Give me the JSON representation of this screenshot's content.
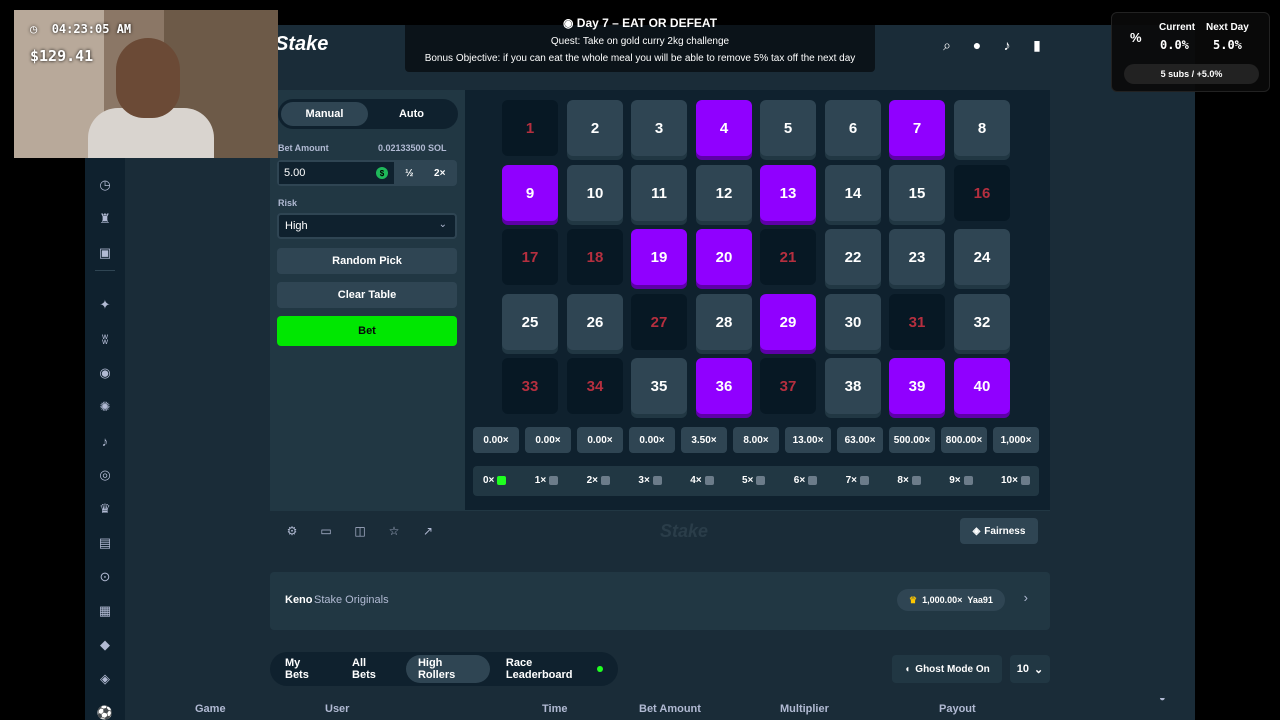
{
  "topbar": {
    "logo": "Stake"
  },
  "panel": {
    "tab_manual": "Manual",
    "tab_auto": "Auto",
    "bet_amount_label": "Bet Amount",
    "bet_amount_sol": "0.02133500 SOL",
    "bet_value": "5.00",
    "half_label": "½",
    "double_label": "2×",
    "risk_label": "Risk",
    "risk_value": "High",
    "random_pick": "Random Pick",
    "clear_table": "Clear Table",
    "bet_button": "Bet"
  },
  "board": {
    "numbers": [
      "1",
      "2",
      "3",
      "4",
      "5",
      "6",
      "7",
      "8",
      "9",
      "10",
      "11",
      "12",
      "13",
      "14",
      "15",
      "16",
      "17",
      "18",
      "19",
      "20",
      "21",
      "22",
      "23",
      "24",
      "25",
      "26",
      "27",
      "28",
      "29",
      "30",
      "31",
      "32",
      "33",
      "34",
      "35",
      "36",
      "37",
      "38",
      "39",
      "40"
    ],
    "picked": [
      4,
      7,
      9,
      13,
      19,
      20,
      29,
      36,
      39,
      40
    ],
    "missed": [
      1,
      16,
      17,
      18,
      21,
      27,
      31,
      33,
      34,
      37
    ],
    "multipliers": [
      "0.00×",
      "0.00×",
      "0.00×",
      "0.00×",
      "3.50×",
      "8.00×",
      "13.00×",
      "63.00×",
      "500.00×",
      "800.00×",
      "1,000×"
    ],
    "hits": [
      "0×",
      "1×",
      "2×",
      "3×",
      "4×",
      "5×",
      "6×",
      "7×",
      "8×",
      "9×",
      "10×"
    ]
  },
  "toolbar": {
    "watermark": "Stake",
    "fairness": "Fairness"
  },
  "info": {
    "game": "Keno",
    "owner": "Stake Originals",
    "record_mult": "1,000.00×",
    "record_user": "Yaa91"
  },
  "bets": {
    "tabs": [
      "My Bets",
      "All Bets",
      "High Rollers",
      "Race Leaderboard"
    ],
    "ghost_mode": "Ghost Mode On",
    "count": "10",
    "columns": [
      "Game",
      "User",
      "Time",
      "Bet Amount",
      "Multiplier",
      "Payout"
    ]
  },
  "overlay": {
    "clock": "04:23:05 AM",
    "balance": "$129.41",
    "challenge_title": "Day 7 – EAT OR DEFEAT",
    "quest": "Quest: Take on gold curry 2kg challenge",
    "bonus": "Bonus Objective: if you can eat the whole meal you will be able to remove 5% tax off the next day",
    "tax_current_label": "Current",
    "tax_current": "0.0%",
    "tax_next_label": "Next Day",
    "tax_next": "5.0%",
    "subs": "5 subs / +5.0%"
  },
  "colors": {
    "pick": "#9000ff",
    "bet_green": "#00e701",
    "bg": "#1a2c38",
    "miss": "#b52f3f"
  }
}
